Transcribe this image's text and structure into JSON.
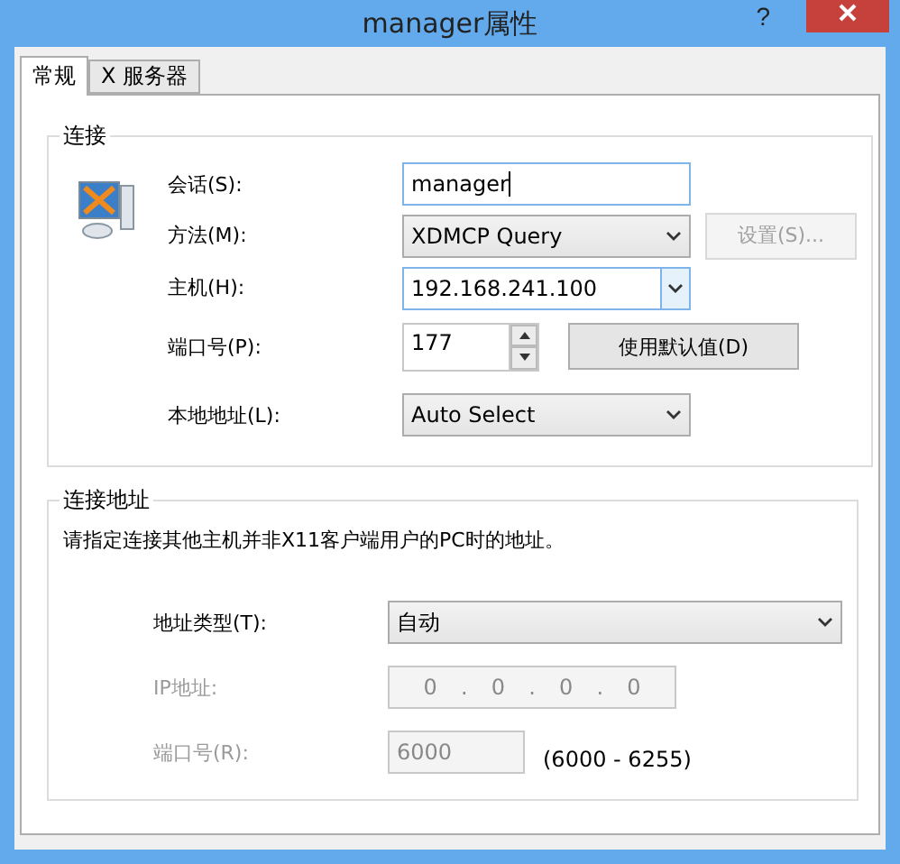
{
  "window": {
    "title": "manager属性",
    "help": "?"
  },
  "tabs": [
    {
      "label": "常规",
      "selected": true
    },
    {
      "label": "X 服务器",
      "selected": false
    }
  ],
  "connection": {
    "legend": "连接",
    "rows": [
      {
        "label": "会话(S):",
        "kind": "text",
        "value": "manager",
        "focused": true,
        "disabled": false
      },
      {
        "label": "方法(M):",
        "kind": "dropdown",
        "value": "XDMCP Query",
        "disabled": false,
        "button": {
          "label": "设置(S)...",
          "disabled": true
        }
      },
      {
        "label": "主机(H):",
        "kind": "combo",
        "value": "192.168.241.100",
        "disabled": false
      },
      {
        "label": "端口号(P):",
        "kind": "spinner",
        "value": "177",
        "disabled": false,
        "button": {
          "label": "使用默认值(D)",
          "disabled": false
        }
      },
      {
        "label": "本地地址(L):",
        "kind": "dropdown",
        "value": "Auto Select",
        "disabled": false
      }
    ]
  },
  "address": {
    "legend": "连接地址",
    "description": "请指定连接其他主机并非X11客户端用户的PC时的地址。",
    "rows": [
      {
        "label": "地址类型(T):",
        "kind": "dropdown",
        "value": "自动",
        "wide": true,
        "disabled": false
      },
      {
        "label": "IP地址:",
        "kind": "ip",
        "octets": [
          "0",
          "0",
          "0",
          "0"
        ],
        "separator": ".",
        "disabled": true
      },
      {
        "label": "端口号(R):",
        "kind": "text",
        "value": "6000",
        "disabled": true,
        "note": "(6000 - 6255)"
      }
    ]
  }
}
